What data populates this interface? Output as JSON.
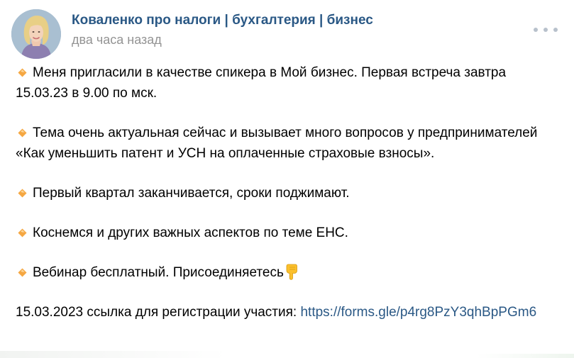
{
  "post": {
    "author": "Коваленко про налоги | бухгалтерия | бизнес",
    "time": "два часа назад",
    "icons": {
      "avatar": "author-avatar",
      "more": "more-options-icon",
      "bullet": "orange-diamond-icon",
      "hand": "pointing-down-hand-icon"
    },
    "colors": {
      "link": "#2a5885",
      "muted": "#939393",
      "bullet": "#f5a742"
    },
    "paragraphs": [
      "Меня пригласили в качестве спикера в Мой бизнес. Первая встреча завтра 15.03.23 в 9.00 по мск.",
      "Тема очень актуальная сейчас и вызывает много вопросов у предпринимателей «Как уменьшить патент и УСН на оплаченные страховые взносы».",
      "Первый квартал заканчивается, сроки поджимают.",
      "Коснемся и других важных аспектов по теме ЕНС.",
      "Вебинар бесплатный. Присоединяетесь"
    ],
    "registration": {
      "text": "15.03.2023 ссылка для регистрации участия: ",
      "link": "https://forms.gle/p4rg8PzY3qhBpPGm6"
    }
  }
}
